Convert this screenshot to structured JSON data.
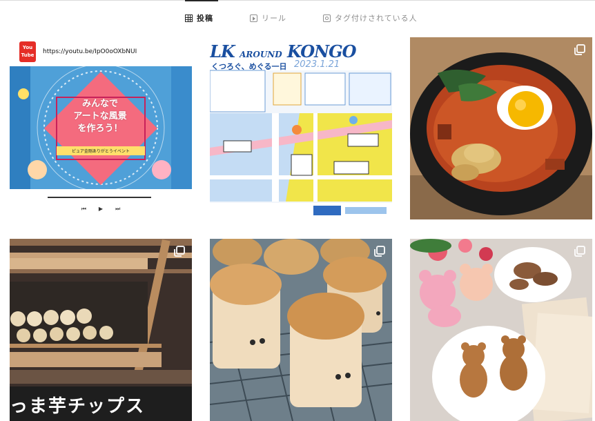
{
  "tabs": [
    {
      "label": "投稿",
      "icon": "grid-icon",
      "active": true
    },
    {
      "label": "リール",
      "icon": "reels-icon",
      "active": false
    },
    {
      "label": "タグ付けされている人",
      "icon": "tagged-icon",
      "active": false
    }
  ],
  "posts": {
    "youtube": {
      "logo_text": "You Tube",
      "url": "https://youtu.be/IpO0oOXbNUI",
      "poster_text_1": "みんなで",
      "poster_text_2": "アートな風景",
      "poster_text_3": "を作ろう！",
      "poster_sub": "ピュア金剛ありがとうイベント",
      "controls": {
        "prev": "⏮",
        "play": "▶",
        "next": "⏭"
      }
    },
    "map": {
      "title_left": "LK",
      "title_around": "AROUND",
      "title_right": "KONGO",
      "subtitle": "くつろぐ、めぐる一日",
      "date": "2023.1.21"
    },
    "shop": {
      "sign_text": "っま芋チップス"
    }
  },
  "colors": {
    "accent_text": "#262626",
    "muted_text": "#8e8e8e",
    "divider": "#dbdbdb",
    "youtube_red": "#e52d27",
    "map_blue": "#1a4fa0"
  }
}
